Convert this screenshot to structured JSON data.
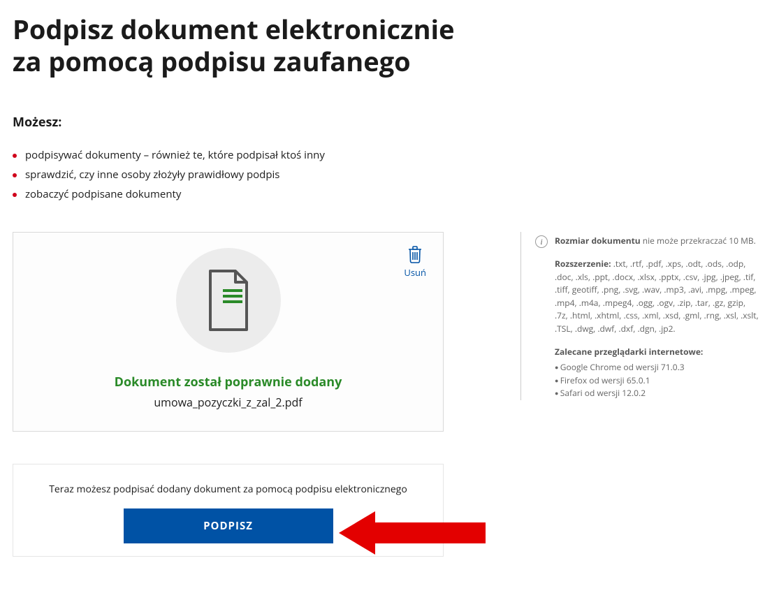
{
  "header": {
    "title_line1": "Podpisz dokument elektronicznie",
    "title_line2": "za pomocą podpisu zaufanego"
  },
  "intro": {
    "subhead": "Możesz:",
    "features": [
      "podpisywać dokumenty – również te, które podpisał ktoś inny",
      "sprawdzić, czy inne osoby złożyły prawidłowy podpis",
      "zobaczyć podpisane dokumenty"
    ]
  },
  "upload": {
    "delete_label": "Usuń",
    "success_message": "Dokument został poprawnie dodany",
    "filename": "umowa_pozyczki_z_zal_2.pdf"
  },
  "sign": {
    "instruction": "Teraz możesz podpisać dodany dokument za pomocą podpisu elektronicznego",
    "button_label": "PODPISZ"
  },
  "info": {
    "size_label": "Rozmiar dokumentu",
    "size_text": " nie może przekraczać 10 MB.",
    "ext_label": "Rozszerzenie:",
    "ext_text": " .txt, .rtf, .pdf, .xps, .odt, .ods, .odp, .doc, .xls, .ppt, .docx, .xlsx, .pptx, .csv, .jpg, .jpeg, .tif, .tiff, geotiff, .png, .svg, .wav, .mp3, .avi, .mpg, .mpeg, .mp4, .m4a, .mpeg4, .ogg, .ogv, .zip, .tar, .gz, gzip, .7z, .html, .xhtml, .css, .xml, .xsd, .gml, .rng, .xsl, .xslt, .TSL, .dwg, .dwf, .dxf, .dgn, .jp2.",
    "browsers_label": "Zalecane przeglądarki internetowe:",
    "browsers": [
      "Google Chrome od wersji 71.0.3",
      "Firefox od wersji 65.0.1",
      "Safari od wersji 12.0.2"
    ]
  }
}
